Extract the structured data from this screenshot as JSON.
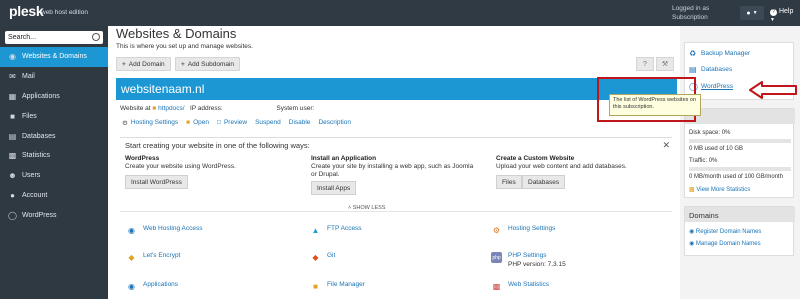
{
  "topbar": {
    "logo": "plesk",
    "logo_sub": "web host edition",
    "logged_in": "Logged in as",
    "subscription": "Subscription",
    "help": "Help"
  },
  "sidebar": {
    "search_placeholder": "Search...",
    "items": [
      {
        "label": "Websites & Domains",
        "icon": "globe-icon"
      },
      {
        "label": "Mail",
        "icon": "mail-icon"
      },
      {
        "label": "Applications",
        "icon": "apps-icon"
      },
      {
        "label": "Files",
        "icon": "folder-icon"
      },
      {
        "label": "Databases",
        "icon": "database-icon"
      },
      {
        "label": "Statistics",
        "icon": "chart-icon"
      },
      {
        "label": "Users",
        "icon": "users-icon"
      },
      {
        "label": "Account",
        "icon": "account-icon"
      },
      {
        "label": "WordPress",
        "icon": "wordpress-icon"
      }
    ]
  },
  "main": {
    "title": "Websites & Domains",
    "description": "This is where you set up and manage websites.",
    "add_domain": "Add Domain",
    "add_subdomain": "Add Subdomain",
    "domain_name": "websitenaam.nl",
    "website_at_label": "Website at",
    "website_at_link": "httpdocs/",
    "ip_label": "IP address:",
    "system_user_label": "System user:",
    "actions": [
      "Hosting Settings",
      "Open",
      "Preview",
      "Suspend",
      "Disable",
      "Description"
    ],
    "start_title": "Start creating your website in one of the following ways:",
    "wordpress_head": "WordPress",
    "wordpress_desc": "Create your website using WordPress.",
    "install_wordpress": "Install WordPress",
    "app_head": "Install an Application",
    "app_desc1": "Create your site by installing a web app, such as Joomla",
    "app_desc2": "or Drupal.",
    "install_apps": "Install Apps",
    "custom_head": "Create a Custom Website",
    "custom_desc": "Upload your web content and add databases.",
    "files_btn": "Files",
    "databases_btn": "Databases",
    "show_less": "SHOW LESS",
    "tools": [
      {
        "label": "Web Hosting Access"
      },
      {
        "label": "FTP Access"
      },
      {
        "label": "Hosting Settings"
      },
      {
        "label": "Let's Encrypt"
      },
      {
        "label": "Git"
      },
      {
        "label": "PHP Settings",
        "sub": "PHP version: 7.3.15"
      },
      {
        "label": "Applications"
      },
      {
        "label": "File Manager"
      },
      {
        "label": "Web Statistics"
      }
    ]
  },
  "right": {
    "links": [
      "Backup Manager",
      "Databases",
      "WordPress"
    ],
    "tooltip": "The list of WordPress websites on this subscription.",
    "usage_disk_label": "Disk space:",
    "usage_disk_pct": "0%",
    "usage_disk_text": "0 MB used of 10 GB",
    "usage_traffic_label": "Traffic:",
    "usage_traffic_pct": "0%",
    "usage_traffic_text": "0 MB/month used of 100 GB/month",
    "view_more": "View More Statistics",
    "domains_head": "Domains",
    "register": "Register Domain Names",
    "manage": "Manage Domain Names"
  },
  "colors": {
    "accent": "#1d97d3",
    "sidebar_bg": "#2e3942",
    "topbar_bg": "#2f3a45",
    "annotation_red": "#c0161b"
  }
}
